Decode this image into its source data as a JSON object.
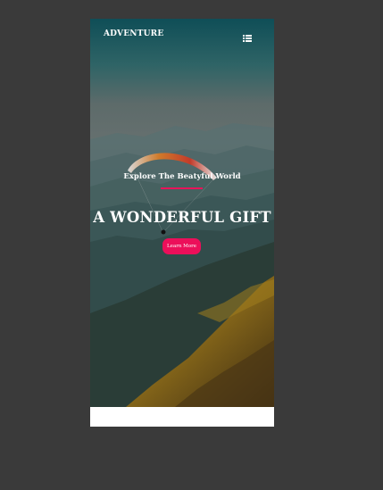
{
  "nav": {
    "brand": "ADVENTURE",
    "menu_icon": "list-icon"
  },
  "hero": {
    "subtitle": "Explore The Beatyful World",
    "headline": "A WONDERFUL GIFT",
    "cta_label": "Learn More",
    "accent_color": "#ec0f5a"
  }
}
